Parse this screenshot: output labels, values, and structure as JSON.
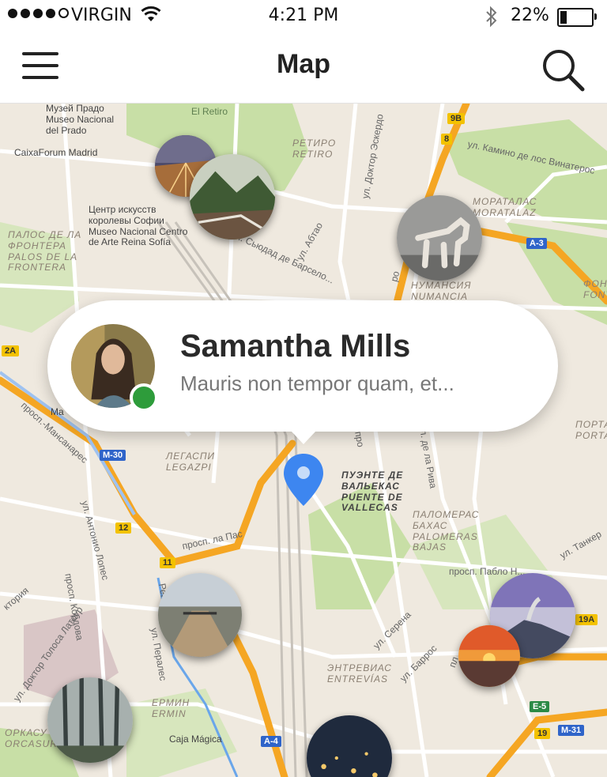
{
  "status_bar": {
    "carrier": "VIRGIN",
    "time": "4:21 PM",
    "battery_pct": "22%",
    "battery_level": 0.22,
    "signal_bars": 4,
    "icons": [
      "signal-dots-icon",
      "wifi-icon",
      "bluetooth-icon",
      "battery-icon"
    ]
  },
  "navbar": {
    "title": "Map",
    "left_icon": "hamburger-menu-icon",
    "right_icon": "search-icon"
  },
  "popup": {
    "name": "Samantha Mills",
    "subtitle": "Mauris non tempor quam, et...",
    "status_color": "#2e9c3b"
  },
  "map_labels": {
    "prado": "Музей Прадо\nMuseo Nacional\ndel Prado",
    "retiro_park": "El Retiro",
    "retiro": "РЕТИРО\nRETIRO",
    "caixa": "CaixaForum Madrid",
    "reina_sofia": "Центр искусств\nкоролевы Софии\nMuseo Nacional Centro\nde Arte Reina Sofía",
    "palos": "ПАЛОС ДЕ ЛА\nФРОНТЕРА\nPALOS DE LA\nFRONTERA",
    "moratalaz": "МОРАТАЛАС\nMORATALAZ",
    "numancia": "НУМАНСИЯ\nNUMANCIA",
    "camino": "ул. Камино де лос Винатерос",
    "doktor_esquerdo": "ул. Доктор Эскердо",
    "abtao": "ул. Абтао",
    "ciudad": "просп. Сьюдад де Барсело...",
    "portaz": "ПОРТА\nPORTAZ",
    "fonte": "ФОНТ\nFONT",
    "legazpi": "ЛЕГАСПИ\nLEGAZPI",
    "vallecas": "ПУЭНТЕ ДЕ\nВАЛЬЕКАС\nPUENTE DE\nVALLECAS",
    "palomeras": "ПАЛОМЕРАС\nБАХАС\nPALOMERAS\nBAJAS",
    "manzanares": "просп.-Мансанарес",
    "rivas": "ул. де ла Рива",
    "pablo": "просп. Пабло Н...",
    "tanker": "ул. Танкер",
    "lapaz": "просп. ла Пас",
    "antonio": "ул. Антонио Лопес",
    "cordova": "просп. Кордова",
    "toledo": "ул. Доктор Толоса Латоур",
    "perales": "ул. Пералес",
    "serena": "ул. Серена",
    "barros": "ул. Баррос",
    "entrevias": "ЭНТРЕВИАС\nENTREVÍAS",
    "hermin": "ЕРМИН\nERMIN",
    "caja_magica": "Caja Mágica",
    "orcasur": "ОРКАСУ\nORCASUR",
    "ma": "Ma",
    "ktoria": "ктория",
    "ro": "ро",
    "rek": "Рек",
    "pro": "про",
    "pl": "пл"
  },
  "road_shields": {
    "m30": "M-30",
    "a3": "A-3",
    "a4": "A-4",
    "m31": "M-31",
    "e5": "E-5",
    "s19a": "19A",
    "s19": "19",
    "s9b": "9B",
    "s8": "8",
    "s12": "12",
    "s11": "11",
    "s2a": "2A"
  },
  "colors": {
    "map_bg": "#efe9df",
    "park": "#c8dfa6",
    "highway": "#f5a623",
    "road": "#ffffff",
    "pin": "#3d86f0"
  }
}
